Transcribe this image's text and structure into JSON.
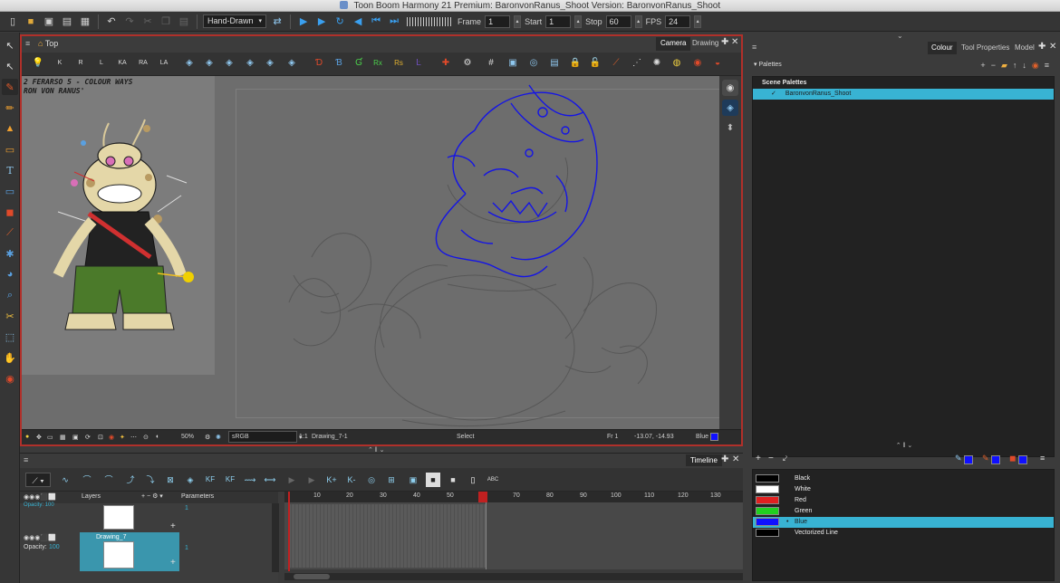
{
  "window": {
    "title": "Toon Boom Harmony 21 Premium: BaronvonRanus_Shoot Version: BaronvonRanus_Shoot"
  },
  "toolbar": {
    "mode_select": "Hand-Drawn",
    "frame_label": "Frame",
    "frame_value": "1",
    "start_label": "Start",
    "start_value": "1",
    "stop_label": "Stop",
    "stop_value": "60",
    "fps_label": "FPS",
    "fps_value": "24"
  },
  "camera_panel": {
    "breadcrumb": "Top",
    "tabs": [
      "Camera",
      "Drawing"
    ],
    "pen_buttons": [
      "K",
      "R",
      "L",
      "KA",
      "RA",
      "LA"
    ],
    "layer_buttons": [
      "Rx",
      "Rs"
    ],
    "reference_text": [
      "2 FERARSO 5 - COLOUR WAYS",
      "RON VON RANUS'"
    ],
    "status": {
      "zoom": "50%",
      "color_space": "sRGB",
      "drawing": "Drawing_7-1",
      "ratio": "1:1",
      "tool": "Select",
      "frame": "Fr 1",
      "coords": "-13.07, -14.93",
      "color_name": "Blue"
    }
  },
  "right_panel": {
    "tabs": [
      "Colour",
      "Tool Properties",
      "Model"
    ],
    "palettes_label": "Palettes",
    "scene_palettes_label": "Scene Palettes",
    "palette_name": "BaronvonRanus_Shoot",
    "swatches": [
      {
        "name": "Black",
        "color": "#000000"
      },
      {
        "name": "White",
        "color": "#ffffff"
      },
      {
        "name": "Red",
        "color": "#e02020"
      },
      {
        "name": "Green",
        "color": "#20d020"
      },
      {
        "name": "Blue",
        "color": "#1010ff",
        "selected": true
      },
      {
        "name": "Vectorized Line",
        "color": "#000000"
      }
    ]
  },
  "timeline": {
    "title": "Timeline",
    "layers_label": "Layers",
    "params_label": "Parameters",
    "layer_name": "Drawing_7",
    "opacity_label": "Opacity:",
    "opacity_value": "100",
    "param_values": [
      "1",
      "1"
    ],
    "ruler": [
      "10",
      "20",
      "30",
      "40",
      "50",
      "60",
      "70",
      "80",
      "90",
      "100",
      "110",
      "120",
      "130"
    ],
    "keyframe_labels": [
      "KF",
      "KF"
    ]
  },
  "colors": {
    "accent": "#38b3d3",
    "active_border": "#b0302a",
    "stroke": "#1414e6"
  }
}
